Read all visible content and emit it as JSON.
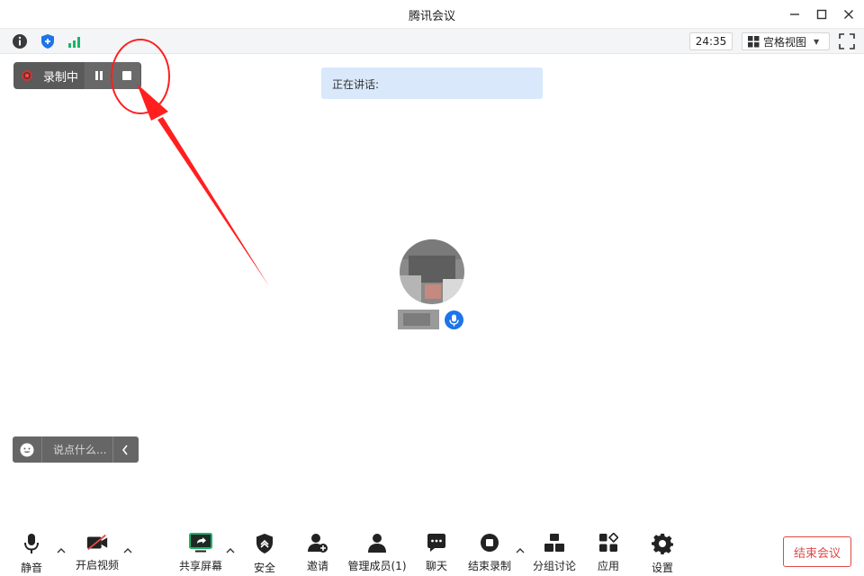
{
  "window": {
    "title": "腾讯会议"
  },
  "statusbar": {
    "timer": "24:35",
    "view_mode_label": "宫格视图",
    "icons": [
      "info-icon",
      "shield-icon",
      "signal-icon",
      "fullscreen-icon"
    ]
  },
  "recording": {
    "label": "录制中",
    "status_color": "#ff4d4d"
  },
  "speaking": {
    "text": "正在讲话:"
  },
  "chat": {
    "placeholder": "说点什么..."
  },
  "toolbar": {
    "mute_label": "静音",
    "video_label": "开启视频",
    "share_label": "共享屏幕",
    "security_label": "安全",
    "invite_label": "邀请",
    "members_label": "管理成员(1)",
    "chat_label": "聊天",
    "end_record_label": "结束录制",
    "breakout_label": "分组讨论",
    "apps_label": "应用",
    "settings_label": "设置",
    "end_meeting_label": "结束会议"
  },
  "colors": {
    "accent": "#1e74e8",
    "danger": "#e04848",
    "annotation": "#ff1f1f",
    "share_green": "#1db46a"
  }
}
